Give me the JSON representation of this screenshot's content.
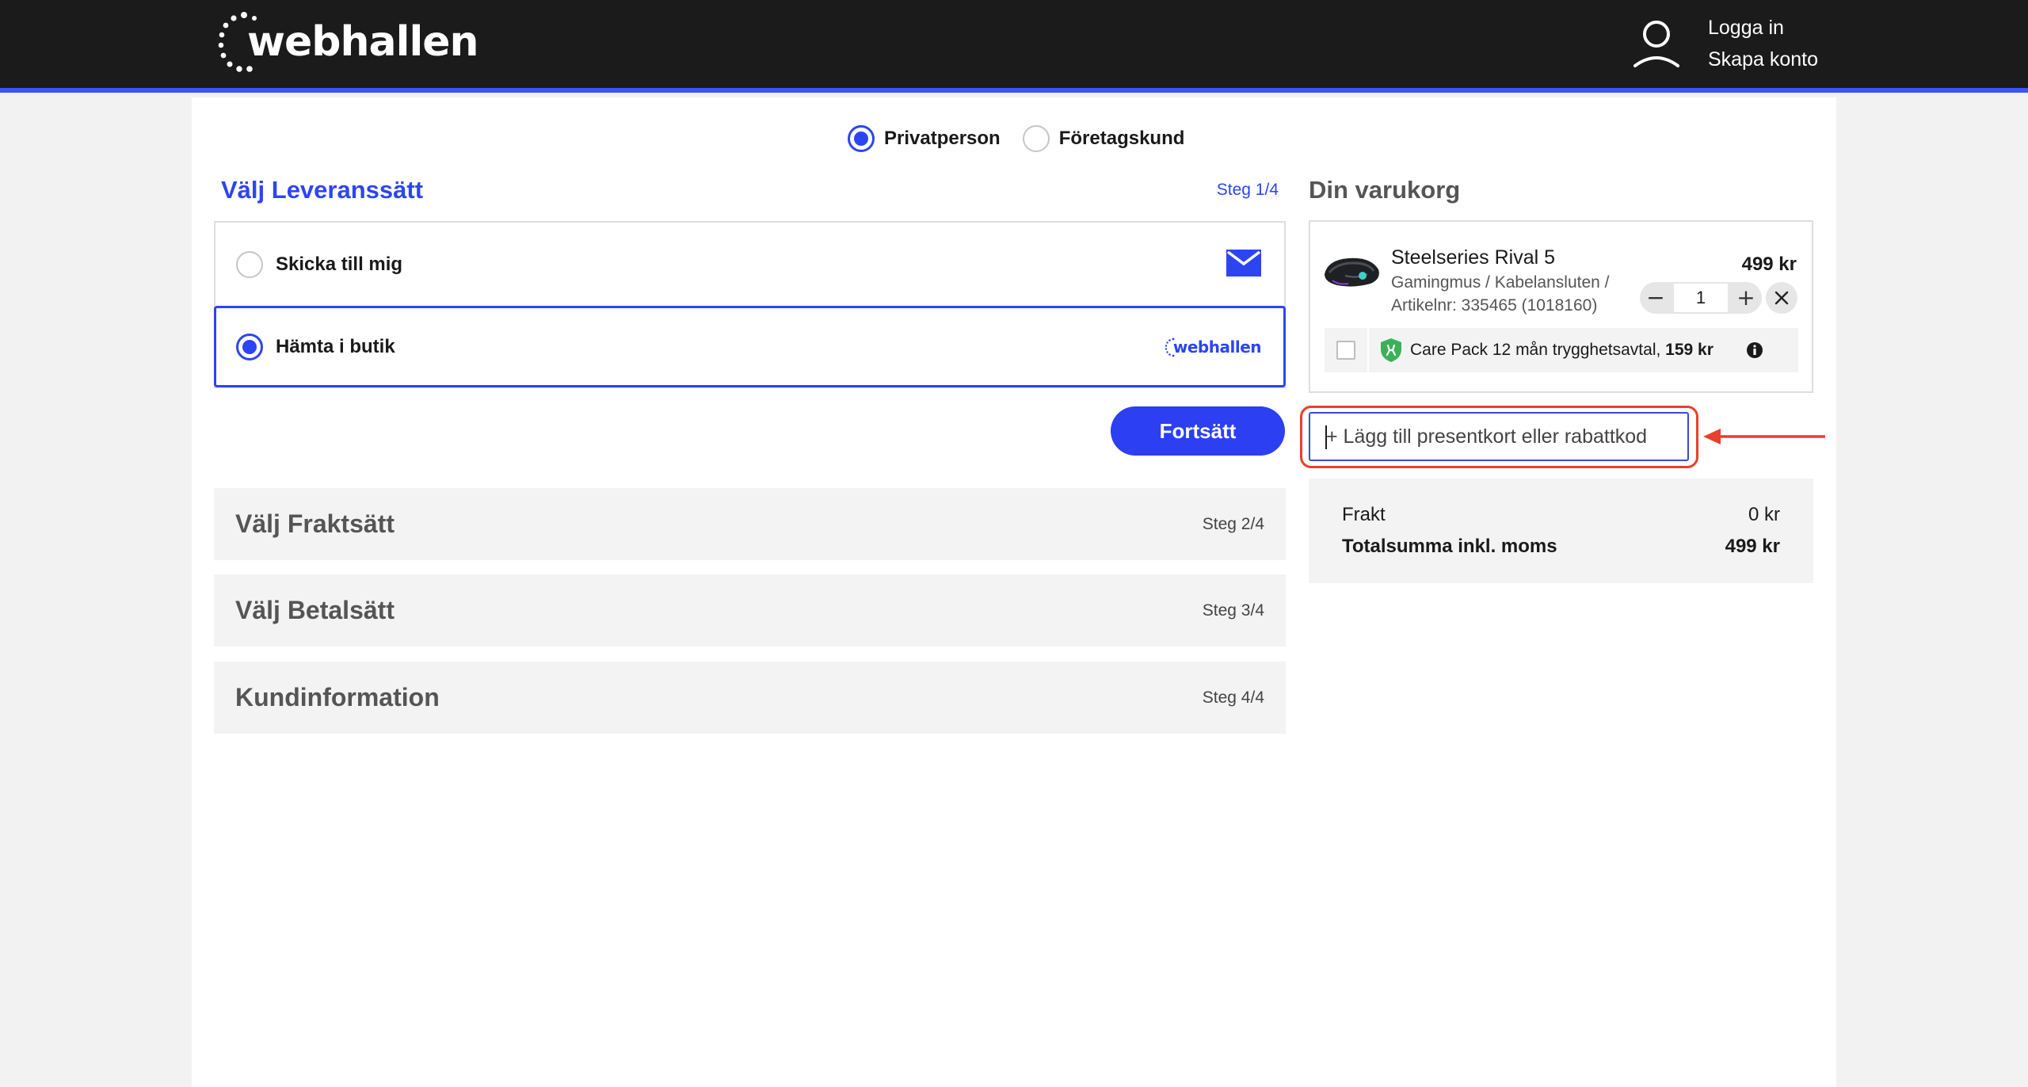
{
  "header": {
    "logo_text": "webhallen",
    "login_label": "Logga in",
    "signup_label": "Skapa konto"
  },
  "customer_type": {
    "options": [
      {
        "label": "Privatperson",
        "selected": true
      },
      {
        "label": "Företagskund",
        "selected": false
      }
    ]
  },
  "delivery_step": {
    "title": "Välj Leveranssätt",
    "step_label": "Steg 1/4",
    "options": [
      {
        "label": "Skicka till mig",
        "selected": false,
        "icon": "mail-icon"
      },
      {
        "label": "Hämta i butik",
        "selected": true,
        "icon": "webhallen-logo-icon",
        "logo_text": "webhallen"
      }
    ],
    "continue_label": "Fortsätt"
  },
  "steps": [
    {
      "title": "Välj Fraktsätt",
      "step_label": "Steg 2/4"
    },
    {
      "title": "Välj Betalsätt",
      "step_label": "Steg 3/4"
    },
    {
      "title": "Kundinformation",
      "step_label": "Steg 4/4"
    }
  ],
  "cart": {
    "title": "Din varukorg",
    "item": {
      "name": "Steelseries Rival 5",
      "category": "Gamingmus / Kabelansluten /",
      "article": "Artikelnr: 335465 (1018160)",
      "price": "499 kr",
      "quantity": "1"
    },
    "carepack": {
      "text": "Care Pack 12 mån trygghetsavtal, ",
      "price": "159 kr",
      "checked": false
    },
    "giftcard": {
      "placeholder": "+ Lägg till presentkort eller rabattkod"
    },
    "totals": {
      "shipping_label": "Frakt",
      "shipping_value": "0 kr",
      "total_label": "Totalsumma inkl. moms",
      "total_value": "499 kr"
    }
  },
  "colors": {
    "accent": "#2c45f2",
    "header_bg": "#1b1b1b",
    "highlight": "#e8402c",
    "shield": "#3cb058"
  }
}
